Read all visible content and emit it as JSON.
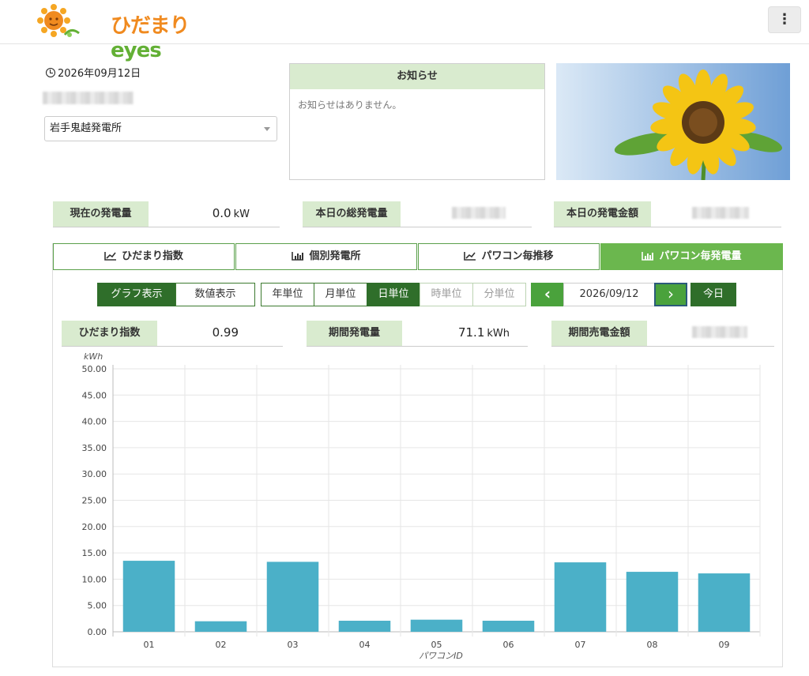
{
  "header": {
    "logo_text_hi": "ひだまり",
    "logo_text_eyes": "eyes",
    "menu_icon": "vertical-dots-icon",
    "menu_glyph": "⋮"
  },
  "date": "2026年09月12日",
  "plant_select": {
    "value": "岩手鬼越発電所"
  },
  "notice": {
    "title": "お知らせ",
    "body": "お知らせはありません。"
  },
  "stats_top": [
    {
      "label": "現在の発電量",
      "value": "0.0",
      "unit": "kW"
    },
    {
      "label": "本日の総発電量"
    },
    {
      "label": "本日の発電金額"
    }
  ],
  "tabs": [
    {
      "label": "ひだまり指数",
      "icon": "line-chart-icon"
    },
    {
      "label": "個別発電所",
      "icon": "bar-chart-icon"
    },
    {
      "label": "パワコン毎推移",
      "icon": "line-chart-icon"
    },
    {
      "label": "パワコン毎発電量",
      "icon": "bar-chart-icon",
      "active": true
    }
  ],
  "view_toggle": [
    {
      "label": "グラフ表示",
      "active": true
    },
    {
      "label": "数値表示"
    }
  ],
  "period_units": [
    {
      "label": "年単位"
    },
    {
      "label": "月単位"
    },
    {
      "label": "日単位",
      "active": true
    },
    {
      "label": "時単位",
      "disabled": true
    },
    {
      "label": "分単位",
      "disabled": true
    }
  ],
  "date_nav": {
    "date": "2026/09/12",
    "today": "今日",
    "prev_icon": "chevron-left-icon",
    "next_icon": "chevron-right-icon",
    "prev_glyph": "‹",
    "next_glyph": "›"
  },
  "stats_period": [
    {
      "label": "ひだまり指数",
      "value": "0.99"
    },
    {
      "label": "期間発電量",
      "value": "71.1",
      "unit": "kWh"
    },
    {
      "label": "期間売電金額"
    }
  ],
  "colors": {
    "accent": "#6bb74e",
    "label_bg": "#d9ebcf",
    "bar": "#4bb0c8",
    "dark_green": "#2f6e2a"
  },
  "chart_data": {
    "type": "bar",
    "ylabel": "kWh",
    "xlabel": "パワコンID",
    "categories": [
      "01",
      "02",
      "03",
      "04",
      "05",
      "06",
      "07",
      "08",
      "09"
    ],
    "values": [
      13.5,
      2.0,
      13.3,
      2.1,
      2.3,
      2.1,
      13.2,
      11.4,
      11.1
    ],
    "ylim": [
      0,
      50
    ],
    "yticks": [
      "0.00",
      "5.00",
      "10.00",
      "15.00",
      "20.00",
      "25.00",
      "30.00",
      "35.00",
      "40.00",
      "45.00",
      "50.00"
    ],
    "grid": true
  }
}
